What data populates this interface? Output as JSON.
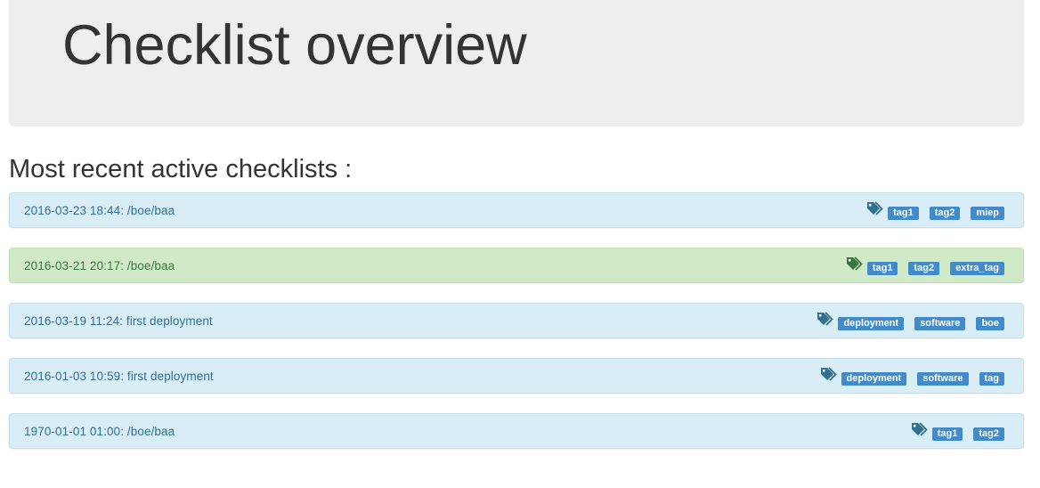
{
  "header": {
    "title": "Checklist overview"
  },
  "section": {
    "heading": "Most recent active checklists :"
  },
  "colors": {
    "info_bg": "#d9edf7",
    "info_text": "#31708f",
    "success_bg": "#d0e9c6",
    "success_text": "#3c763d",
    "badge_bg": "#428bca"
  },
  "checklists": [
    {
      "label": "2016-03-23 18:44: /boe/baa",
      "status": "info",
      "tags": [
        "tag1",
        "tag2",
        "miep"
      ]
    },
    {
      "label": "2016-03-21 20:17: /boe/baa",
      "status": "success",
      "tags": [
        "tag1",
        "tag2",
        "extra_tag"
      ]
    },
    {
      "label": "2016-03-19 11:24: first deployment",
      "status": "info",
      "tags": [
        "deployment",
        "software",
        "boe"
      ]
    },
    {
      "label": "2016-01-03 10:59: first deployment",
      "status": "info",
      "tags": [
        "deployment",
        "software",
        "tag"
      ]
    },
    {
      "label": "1970-01-01 01:00: /boe/baa",
      "status": "info",
      "tags": [
        "tag1",
        "tag2"
      ]
    }
  ],
  "icons": {
    "tags": "tags-icon"
  }
}
